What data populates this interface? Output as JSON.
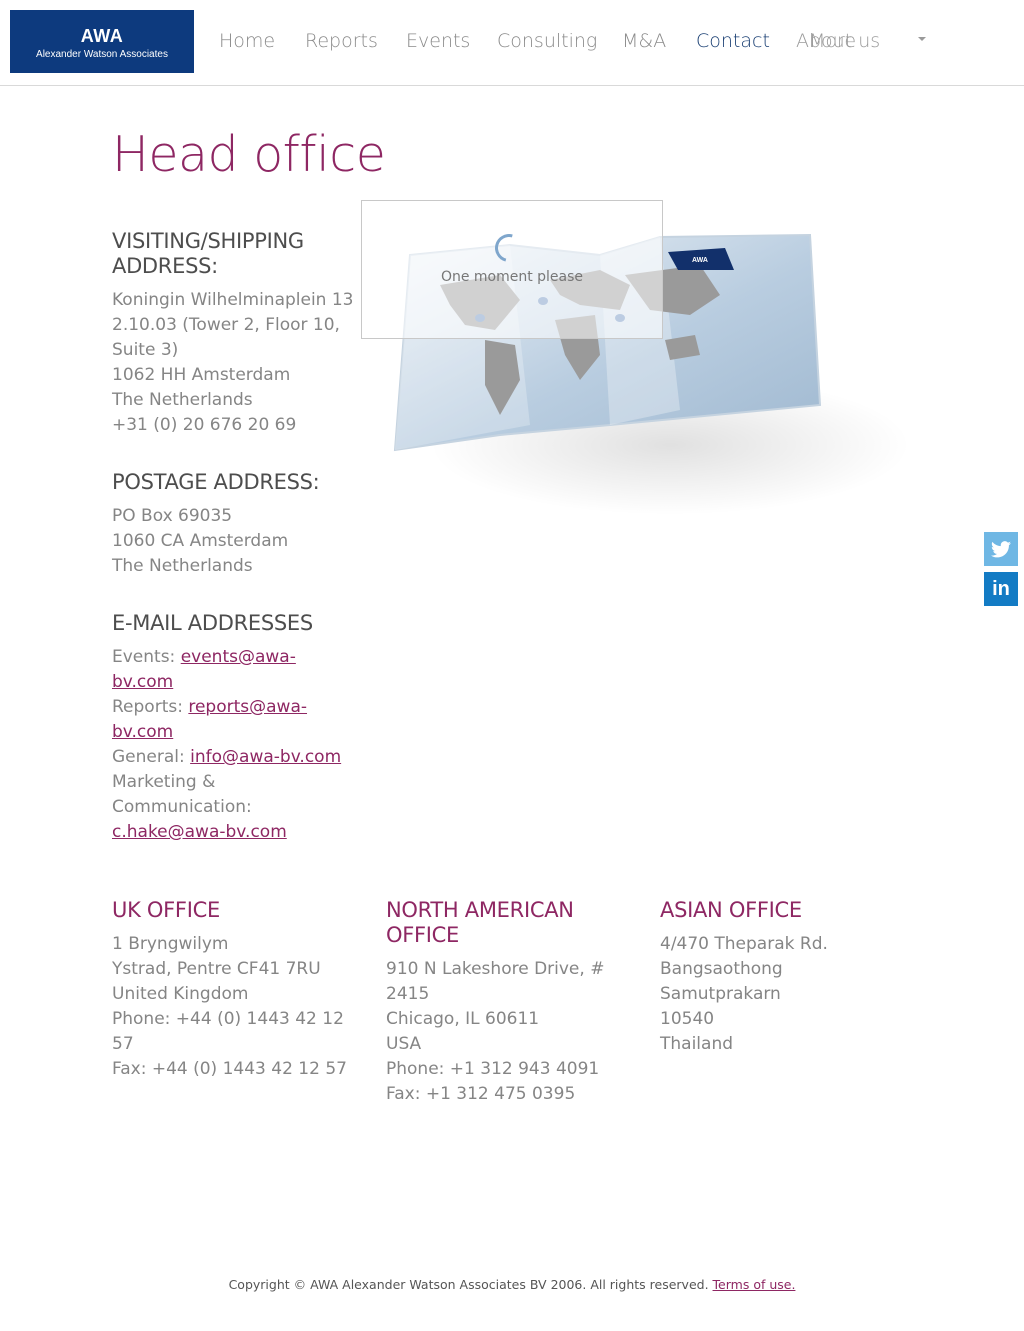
{
  "header": {
    "logo": {
      "main": "AWA",
      "sub": "Alexander Watson Associates"
    },
    "nav": [
      "Home",
      "Reports",
      "Events",
      "Consulting",
      "M&A",
      "Contact",
      "About us",
      "More"
    ]
  },
  "page_title": "Head office",
  "visiting": {
    "heading": "VISITING/SHIPPING ADDRESS:",
    "lines": [
      "Koningin Wilhelminaplein 13",
      "2.10.03 (Tower 2, Floor 10,",
      "Suite 3)",
      "1062 HH Amsterdam",
      "The Netherlands",
      "+31 (0) 20 676 20 69"
    ]
  },
  "postage": {
    "heading": "POSTAGE ADDRESS:",
    "lines": [
      "PO Box 69035",
      "1060 CA Amsterdam",
      "The Netherlands"
    ]
  },
  "email": {
    "heading": "E-MAIL ADDRESSES",
    "events_label": "Events:",
    "events_email": "events@awa-bv.com",
    "reports_label": "Reports:",
    "reports_email": "reports@awa-bv.com",
    "general_label": "General:",
    "general_email": "info@awa-bv.com",
    "marketing_label": "Marketing & Communication:",
    "marketing_email": "c.hake@awa-bv.com"
  },
  "map": {
    "badge": "AWA",
    "loading_text": "One moment please"
  },
  "offices": [
    {
      "heading": "UK OFFICE",
      "lines": [
        "1 Bryngwilym",
        "Ystrad, Pentre CF41 7RU",
        "United Kingdom",
        "Phone: +44 (0) 1443 42 12",
        "57",
        "Fax: +44 (0) 1443 42 12 57"
      ]
    },
    {
      "heading": "NORTH AMERICAN OFFICE",
      "lines": [
        "910 N Lakeshore Drive, #",
        "2415",
        "Chicago, IL 60611",
        "USA",
        "Phone: +1 312 943 4091",
        "Fax: +1 312 475 0395"
      ]
    },
    {
      "heading": "ASIAN OFFICE",
      "lines": [
        "4/470 Theparak Rd.",
        "Bangsaothong",
        "Samutprakarn",
        "10540",
        "Thailand"
      ]
    }
  ],
  "social": {
    "twitter": "twitter-icon",
    "linkedin": "in"
  },
  "footer": {
    "copyright": "Copyright © AWA Alexander Watson Associates BV 2006. All rights reserved.",
    "terms": "Terms of use."
  },
  "colors": {
    "brand_navy": "#0d3a7e",
    "accent": "#8e2763",
    "twitter": "#6fb7e4",
    "linkedin": "#137bc4"
  }
}
